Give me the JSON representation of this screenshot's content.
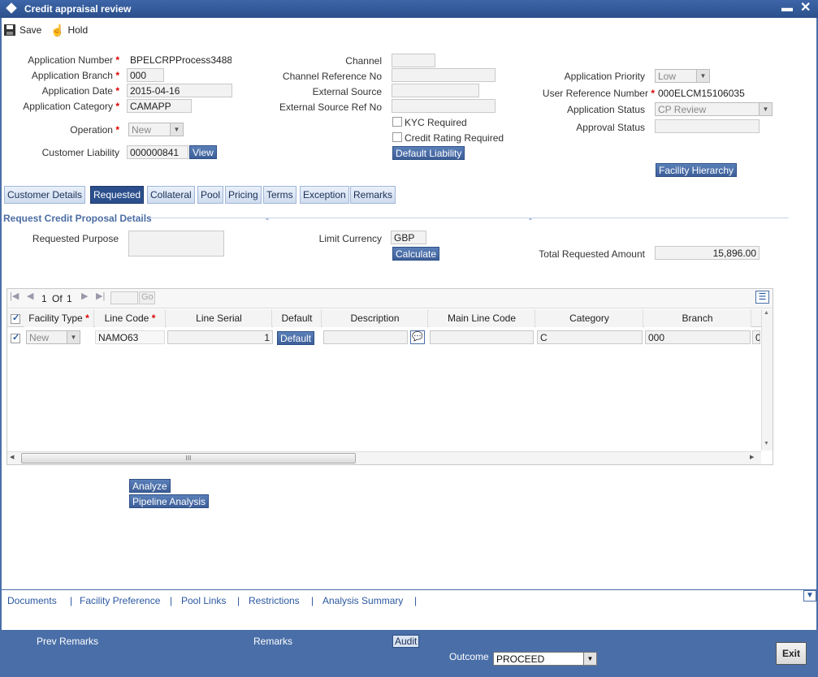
{
  "window": {
    "title": "Credit appraisal review"
  },
  "toolbar": {
    "save_label": "Save",
    "hold_label": "Hold"
  },
  "header": {
    "application_number": {
      "label": "Application Number",
      "value": "BPELCRPProcess3488"
    },
    "application_branch": {
      "label": "Application Branch",
      "value": "000"
    },
    "application_date": {
      "label": "Application Date",
      "value": "2015-04-16"
    },
    "application_category": {
      "label": "Application Category",
      "value": "CAMAPP"
    },
    "operation": {
      "label": "Operation",
      "value": "New"
    },
    "customer_liability": {
      "label": "Customer Liability",
      "value": "000000841",
      "button": "View"
    },
    "channel": {
      "label": "Channel",
      "value": ""
    },
    "channel_reference_no": {
      "label": "Channel Reference No",
      "value": ""
    },
    "external_source": {
      "label": "External Source",
      "value": ""
    },
    "external_source_ref_no": {
      "label": "External Source Ref No",
      "value": ""
    },
    "kyc_required": {
      "label": "KYC Required"
    },
    "credit_rating_required": {
      "label": "Credit Rating Required"
    },
    "default_liability_button": "Default Liability",
    "application_priority": {
      "label": "Application Priority",
      "value": "Low"
    },
    "user_reference_number": {
      "label": "User Reference Number",
      "value": "000ELCM15106035"
    },
    "application_status": {
      "label": "Application Status",
      "value": "CP Review"
    },
    "approval_status": {
      "label": "Approval Status",
      "value": ""
    },
    "facility_hierarchy_button": "Facility Hierarchy"
  },
  "tabs": [
    "Customer Details",
    "Requested",
    "Collateral",
    "Pool",
    "Pricing",
    "Terms",
    "Exception",
    "Remarks"
  ],
  "section": {
    "title": "Request Credit Proposal Details",
    "dash1": "-",
    "dash2": "-",
    "requested_purpose_label": "Requested Purpose",
    "limit_currency_label": "Limit Currency",
    "limit_currency_value": "GBP",
    "calculate_button": "Calculate",
    "total_requested_amount_label": "Total Requested Amount",
    "total_requested_amount_value": "15,896.00"
  },
  "grid": {
    "pager": {
      "current": "1",
      "of_label": "Of",
      "total": "1",
      "go_label": "Go"
    },
    "columns": [
      "Facility Type",
      "Line Code",
      "Line Serial",
      "Default",
      "Description",
      "Main Line Code",
      "Category",
      "Branch"
    ],
    "row": {
      "facility_type": "New",
      "line_code": "NAMO63",
      "line_serial": "1",
      "default_button": "Default",
      "description": "",
      "main_line_code": "",
      "category": "C",
      "branch": "000",
      "next": "0"
    },
    "scroll_mark": "III"
  },
  "actions": {
    "analyze": "Analyze",
    "pipeline_analysis": "Pipeline Analysis"
  },
  "links": [
    "Documents",
    "Facility Preference",
    "Pool Links",
    "Restrictions",
    "Analysis Summary"
  ],
  "link_separator": "|",
  "footer": {
    "prev_remarks": "Prev Remarks",
    "remarks": "Remarks",
    "audit": "Audit",
    "outcome_label": "Outcome",
    "outcome_value": "PROCEED",
    "exit": "Exit"
  },
  "colors": {
    "titlebar": "#2b4f8c",
    "footer": "#4a6fa8",
    "link": "#2a57a0",
    "required": "#dd0000"
  }
}
